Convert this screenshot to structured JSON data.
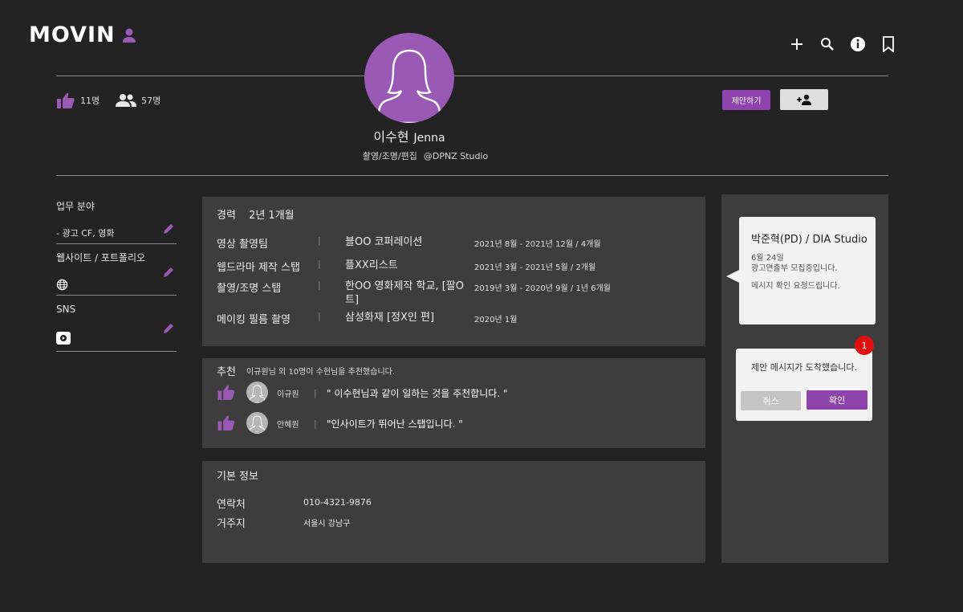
{
  "header": {
    "logo": "MOVIN",
    "icons": [
      "user-icon",
      "plus-icon",
      "search-icon",
      "info-icon",
      "bookmark-icon"
    ]
  },
  "profile": {
    "likes": "11명",
    "followers": "57명",
    "propose_label": "제안하기",
    "name_ko": "이수현",
    "name_en": "Jenna",
    "roles": "촬영/조명/편집",
    "studio": "@DPNZ Studio"
  },
  "sidebar": {
    "work_field": {
      "title": "업무 분야",
      "value": "- 광고 CF, 영화"
    },
    "website": {
      "title": "웹사이트 / 포트폴리오"
    },
    "sns": {
      "title": "SNS"
    }
  },
  "career": {
    "title": "경력",
    "total": "2년 1개월",
    "rows": [
      {
        "role": "영상 촬영팀",
        "company": "블OO 코퍼레이션",
        "period": "2021년 8월 - 2021년 12월 / 4개월"
      },
      {
        "role": "웹드라마 제작 스탭",
        "company": "플XX리스트",
        "period": "2021년 3월 - 2021년 5월 / 2개월"
      },
      {
        "role": "촬영/조명 스탭",
        "company": "한OO 영화제작 학교, [팔O트]",
        "period": "2019년 3월 - 2020년 9월 / 1년 6개월"
      },
      {
        "role": "메이킹 필름 촬영",
        "company": "삼성화재 [정X인 편]",
        "period": "2020년 1월"
      }
    ]
  },
  "recommend": {
    "title": "추천",
    "summary": "이규원님 외 10명이 수현님을 추천했습니다.",
    "rows": [
      {
        "name": "이규원",
        "quote": "\" 이수현님과 같이 일하는 것을 추천합니다. \""
      },
      {
        "name": "안혜원",
        "quote": "\"인사이트가 뛰어난 스탭입니다. \""
      }
    ]
  },
  "basic_info": {
    "title": "기본 정보",
    "contact_label": "연락처",
    "contact": "010-4321-9876",
    "address_label": "거주지",
    "address": "서울시 강남구"
  },
  "message_card": {
    "title": "박준혁(PD) / DIA Studio",
    "date": "6월 24일",
    "line1": "광고연출부 모집중입니다.",
    "line2": "메시지 확인 요청드립니다."
  },
  "dialog": {
    "message": "제안 메시지가 도착했습니다.",
    "cancel": "취소",
    "confirm": "확인",
    "badge": "1"
  },
  "colors": {
    "accent": "#8e44ad",
    "avatar": "#9b59b6",
    "background": "#232323",
    "panel": "#3d3d3d",
    "badge": "#e01010"
  }
}
